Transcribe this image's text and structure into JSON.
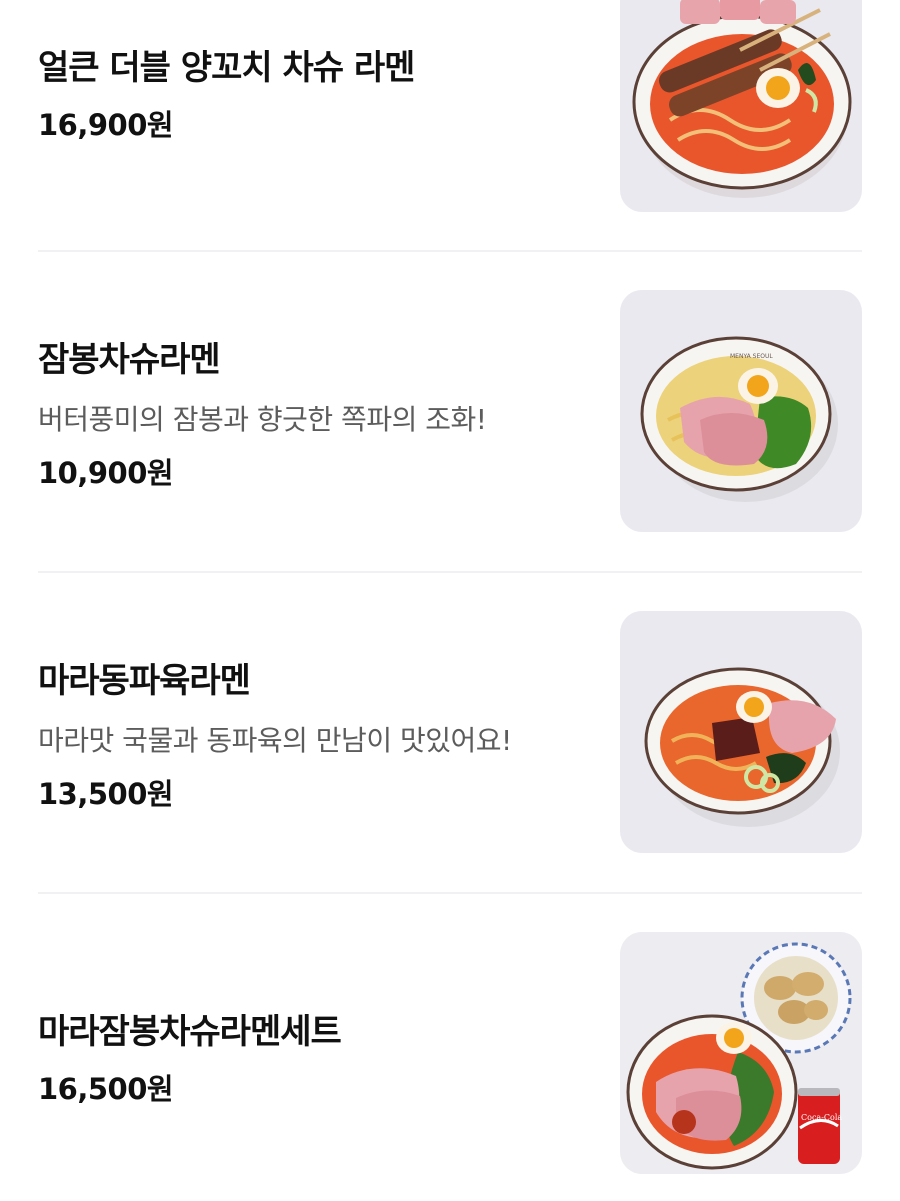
{
  "menu": {
    "items": [
      {
        "name": "얼큰 더블 양꼬치 차슈 라멘",
        "description": "",
        "price": "16,900원",
        "image_icon": "lamb-skewer-spicy-ramen-bowl"
      },
      {
        "name": "잠봉차슈라멘",
        "description": "버터풍미의 잠봉과 향긋한 쪽파의 조화!",
        "price": "10,900원",
        "image_icon": "jambon-chashu-ramen-bowl"
      },
      {
        "name": "마라동파육라멘",
        "description": "마라맛 국물과 동파육의 만남이 맛있어요!",
        "price": "13,500원",
        "image_icon": "mala-dongpo-pork-ramen-bowl"
      },
      {
        "name": "마라잠봉차슈라멘세트",
        "description": "",
        "price": "16,500원",
        "image_icon": "mala-jambon-ramen-set-with-dumplings-and-cola"
      }
    ],
    "bowl_brand_text": "MENYA SEOUL",
    "can_brand_text": "Coca-Cola"
  },
  "colors": {
    "thumb_background": "#e8e8ef",
    "divider": "#f1f1f3",
    "spicy_broth": "#e9562c",
    "egg_yolk": "#f2a51b",
    "scallion_green": "#3b7a2a",
    "cola_red": "#d81e1e"
  }
}
